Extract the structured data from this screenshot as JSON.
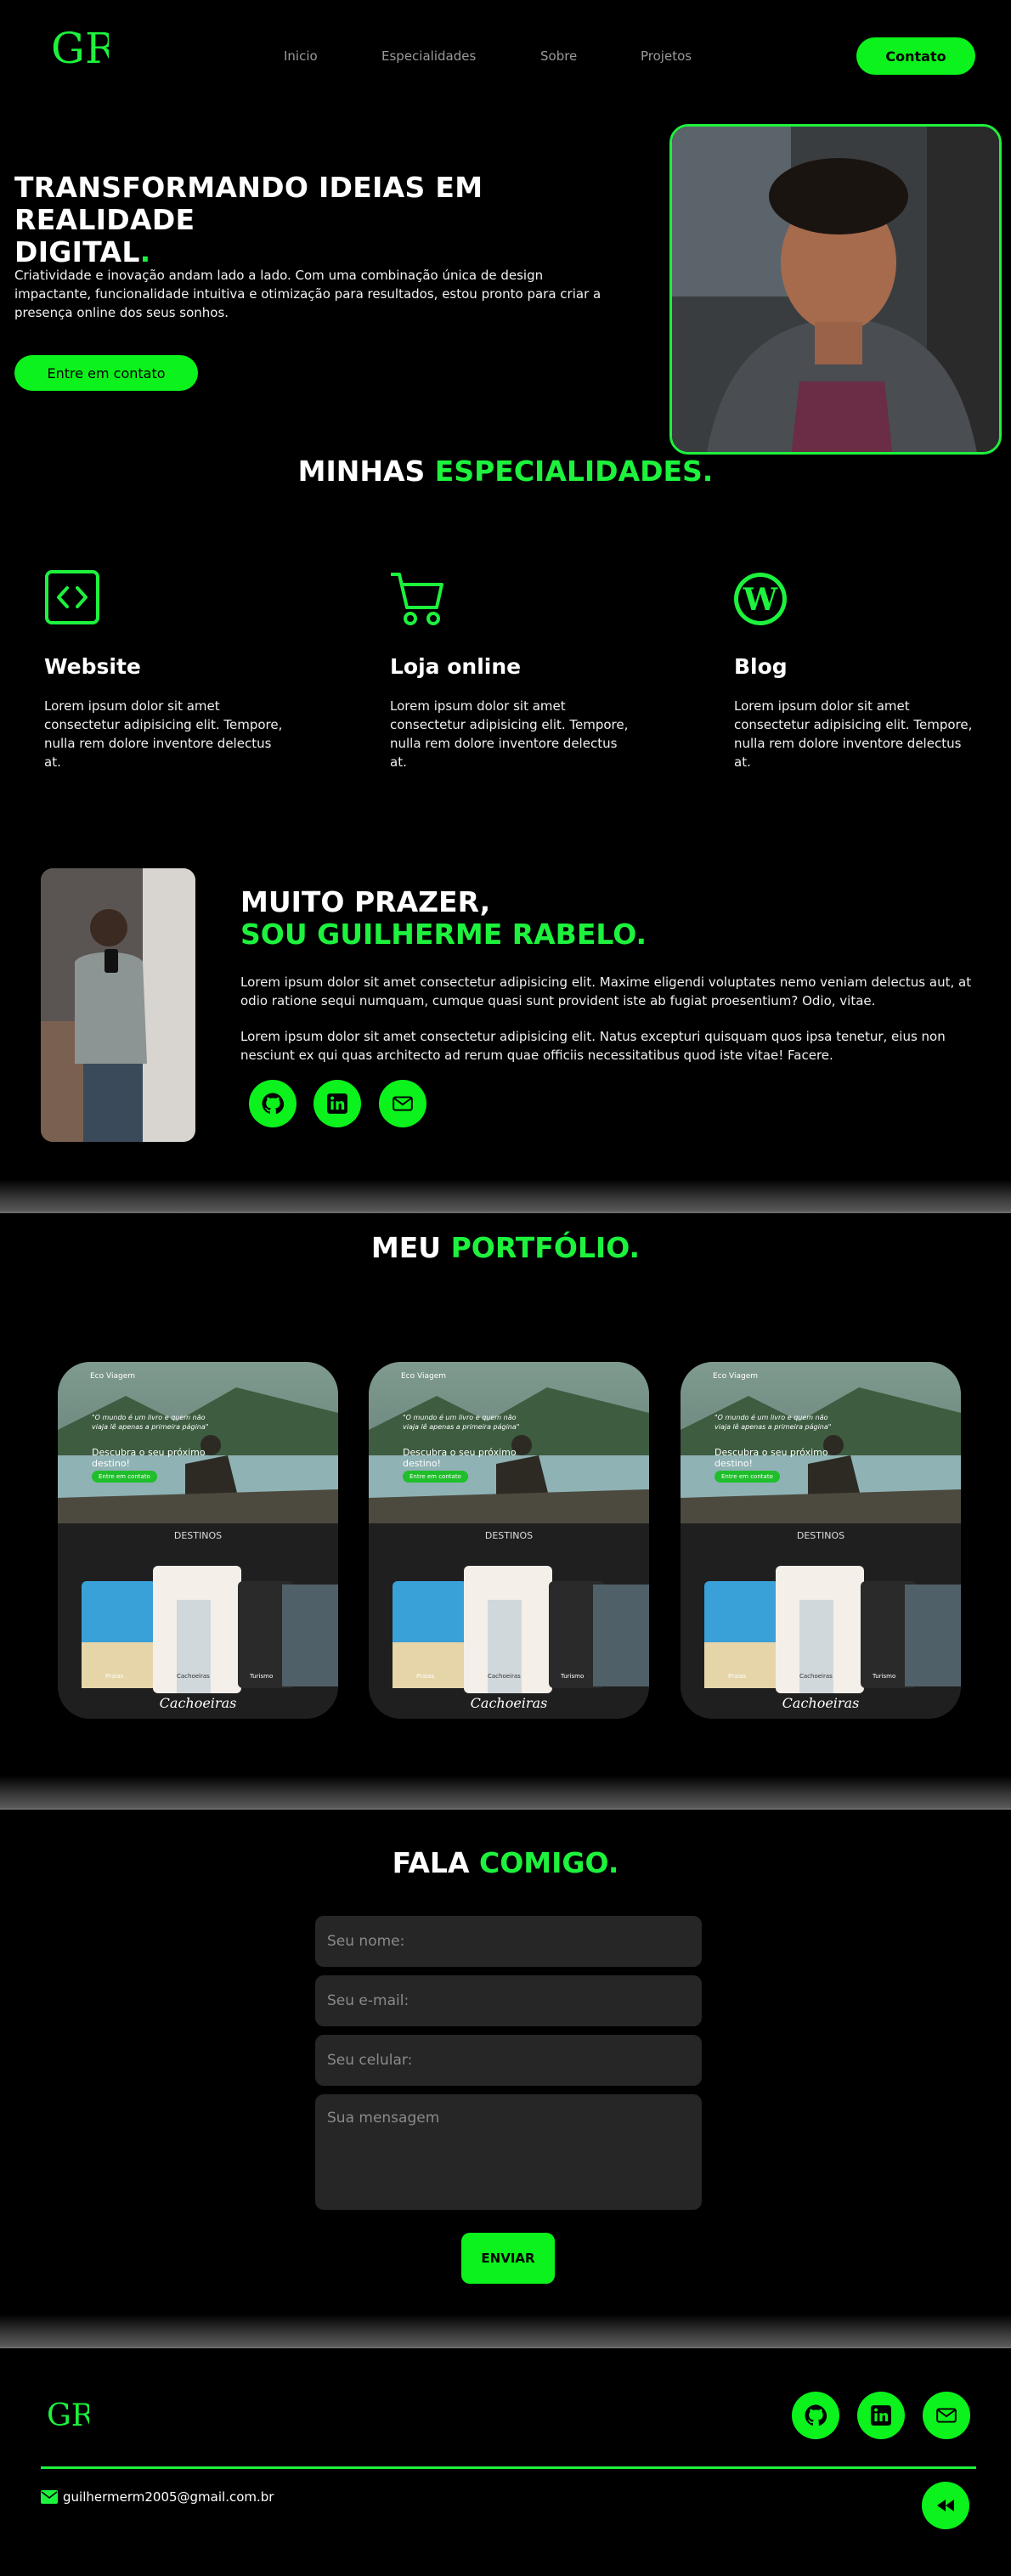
{
  "header": {
    "logo_text": "GR",
    "nav": [
      "Inicio",
      "Especialidades",
      "Sobre",
      "Projetos"
    ],
    "contact_label": "Contato"
  },
  "hero": {
    "title_line1": "TRANSFORMANDO IDEIAS EM REALIDADE",
    "title_line2": "DIGITAL",
    "title_dot": ".",
    "text": "Criatividade e inovação andam lado a lado. Com uma combinação única de design impactante, funcionalidade intuitiva e otimização para resultados, estou pronto para criar a presença online dos seus sonhos.",
    "button": "Entre em contato"
  },
  "specialties": {
    "title_white": "MINHAS",
    "title_green": "ESPECIALIDADES.",
    "items": [
      {
        "icon": "code-icon",
        "title": "Website",
        "text": "Lorem ipsum dolor sit amet consectetur adipisicing elit. Tempore, nulla rem dolore inventore delectus at."
      },
      {
        "icon": "cart-icon",
        "title": "Loja online",
        "text": "Lorem ipsum dolor sit amet consectetur adipisicing elit. Tempore, nulla rem dolore inventore delectus at."
      },
      {
        "icon": "wordpress-icon",
        "title": "Blog",
        "text": "Lorem ipsum dolor sit amet consectetur adipisicing elit. Tempore, nulla rem dolore inventore delectus at."
      }
    ]
  },
  "about": {
    "title_line1": "MUITO PRAZER,",
    "title_line2": "SOU GUILHERME RABELO.",
    "p1": "Lorem ipsum dolor sit amet consectetur adipisicing elit. Maxime eligendi voluptates nemo veniam delectus aut, at odio ratione sequi numquam, cumque quasi sunt provident iste ab fugiat proesentium? Odio, vitae.",
    "p2": "Lorem ipsum dolor sit amet consectetur adipisicing elit. Natus excepturi quisquam quos ipsa tenetur, eius non nesciunt ex qui quas architecto ad rerum quae officiis necessitatibus quod iste vitae! Facere."
  },
  "portfolio": {
    "title_white": "MEU",
    "title_green": "PORTFÓLIO.",
    "card": {
      "brand": "Eco Viagem",
      "quote": "\"O mundo é um livro e quem não viaja lê apenas a primeira página\"",
      "headline": "Descubra o seu próximo destino!",
      "cta": "Entre em contato",
      "section": "DESTINOS",
      "captions": [
        "Praias",
        "Cachoeiras",
        "Turismo"
      ],
      "big_caption": "Cachoeiras"
    }
  },
  "contact": {
    "title_white": "FALA",
    "title_green": "COMIGO.",
    "name_ph": "Seu nome:",
    "email_ph": "Seu e-mail:",
    "phone_ph": "Seu celular:",
    "message_ph": "Sua mensagem",
    "send": "ENVIAR"
  },
  "footer": {
    "logo_text": "GR",
    "email": "guilhermerm2005@gmail.com.br"
  },
  "colors": {
    "accent": "#0cf21c",
    "background": "#000000",
    "field": "#262626"
  }
}
